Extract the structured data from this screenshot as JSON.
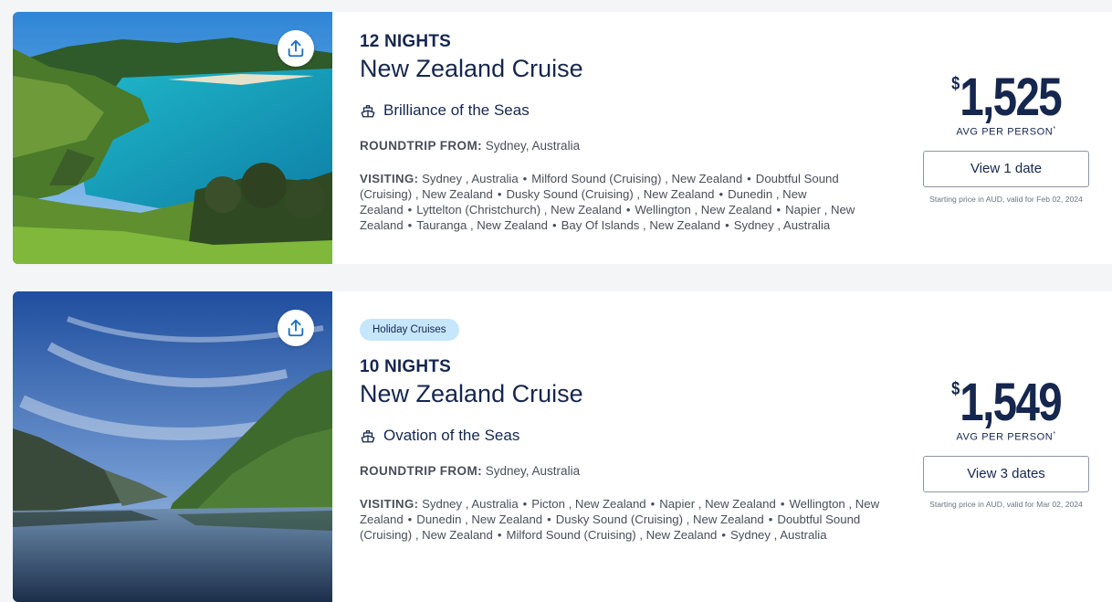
{
  "cruises": [
    {
      "badge": "",
      "nights": "12 NIGHTS",
      "title": "New Zealand Cruise",
      "ship": "Brilliance of the Seas",
      "roundtrip_label": "ROUNDTRIP FROM:",
      "roundtrip_value": "Sydney, Australia",
      "visiting_label": "VISITING:",
      "ports": [
        "Sydney , Australia",
        "Milford Sound (Cruising) , New Zealand",
        "Doubtful Sound (Cruising) , New Zealand",
        "Dusky Sound (Cruising) , New Zealand",
        "Dunedin , New Zealand",
        "Lyttelton (Christchurch) , New Zealand",
        "Wellington , New Zealand",
        "Napier , New Zealand",
        "Tauranga , New Zealand",
        "Bay Of Islands , New Zealand",
        "Sydney , Australia"
      ],
      "currency": "$",
      "price": "1,525",
      "avg_label": "AVG PER PERSON",
      "avg_mark": "*",
      "dates_button": "View 1 date",
      "price_note": "Starting price in AUD, valid for Feb 02, 2024"
    },
    {
      "badge": "Holiday Cruises",
      "nights": "10 NIGHTS",
      "title": "New Zealand Cruise",
      "ship": "Ovation of the Seas",
      "roundtrip_label": "ROUNDTRIP FROM:",
      "roundtrip_value": "Sydney, Australia",
      "visiting_label": "VISITING:",
      "ports": [
        "Sydney , Australia",
        "Picton , New Zealand",
        "Napier , New Zealand",
        "Wellington , New Zealand",
        "Dunedin , New Zealand",
        "Dusky Sound (Cruising) , New Zealand",
        "Doubtful Sound (Cruising) , New Zealand",
        "Milford Sound (Cruising) , New Zealand",
        "Sydney , Australia"
      ],
      "currency": "$",
      "price": "1,549",
      "avg_label": "AVG PER PERSON",
      "avg_mark": "*",
      "dates_button": "View 3 dates",
      "price_note": "Starting price in AUD, valid for Mar 02, 2024"
    }
  ],
  "icons": {
    "share": "share-upload-icon",
    "ship": "ship-icon"
  },
  "colors": {
    "navy": "#15264f",
    "badge_bg": "#c5e6fb",
    "share": "#1a6fc4"
  }
}
